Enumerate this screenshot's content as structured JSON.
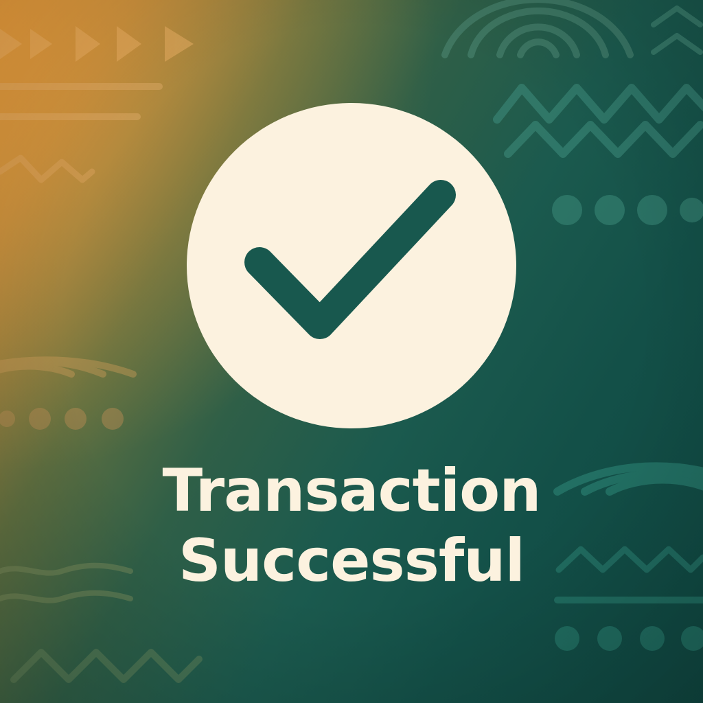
{
  "screen": {
    "status_line_1": "Transaction",
    "status_line_2": "Successful",
    "icon": "check-icon"
  },
  "colors": {
    "gradient_warm": "#e39a3c",
    "gradient_teal": "#135048",
    "circle_fill": "#fcf2df",
    "check_stroke": "#18584e",
    "text": "#fcf2df"
  }
}
